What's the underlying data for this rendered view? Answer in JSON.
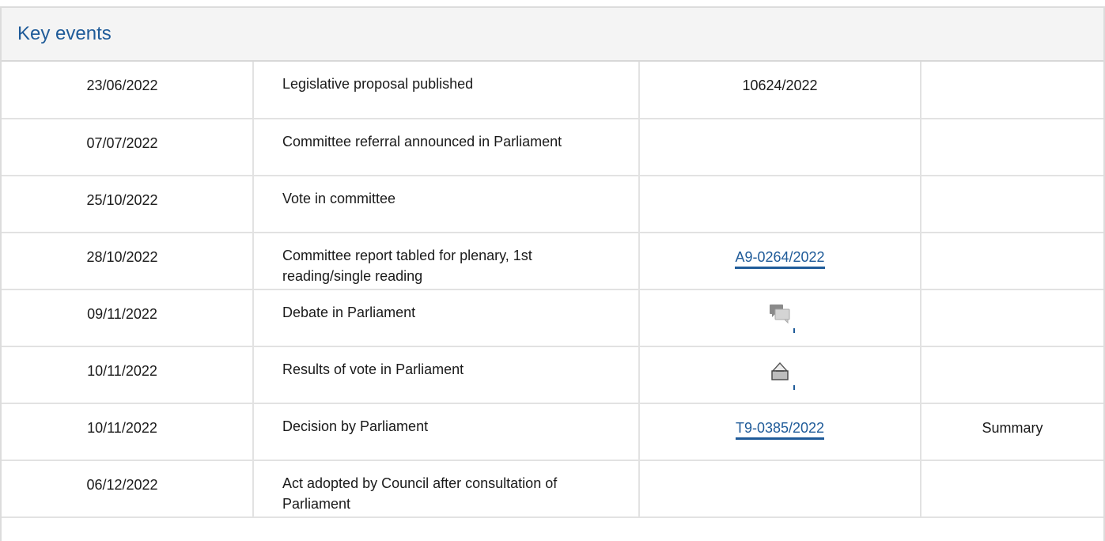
{
  "panel": {
    "title": "Key events"
  },
  "events": [
    {
      "date": "23/06/2022",
      "event": "Legislative proposal published",
      "document": "10624/2022",
      "document_type": "text",
      "summary": ""
    },
    {
      "date": "07/07/2022",
      "event": "Committee referral announced in Parliament",
      "document": "",
      "document_type": "none",
      "summary": ""
    },
    {
      "date": "25/10/2022",
      "event": "Vote in committee",
      "document": "",
      "document_type": "none",
      "summary": ""
    },
    {
      "date": "28/10/2022",
      "event": "Committee report tabled for plenary, 1st reading/single reading",
      "document": "A9-0264/2022",
      "document_type": "link",
      "summary": ""
    },
    {
      "date": "09/11/2022",
      "event": "Debate in Parliament",
      "document": "",
      "document_type": "debate-icon",
      "summary": ""
    },
    {
      "date": "10/11/2022",
      "event": "Results of vote in Parliament",
      "document": "",
      "document_type": "vote-icon",
      "summary": ""
    },
    {
      "date": "10/11/2022",
      "event": "Decision by Parliament",
      "document": "T9-0385/2022",
      "document_type": "link",
      "summary": "Summary"
    },
    {
      "date": "06/12/2022",
      "event": "Act adopted by Council after consultation of Parliament",
      "document": "",
      "document_type": "none",
      "summary": ""
    }
  ],
  "colors": {
    "title": "#1f5b99",
    "link": "#1f5b99",
    "border": "#e2e2e2",
    "header_bg": "#f4f4f4"
  }
}
